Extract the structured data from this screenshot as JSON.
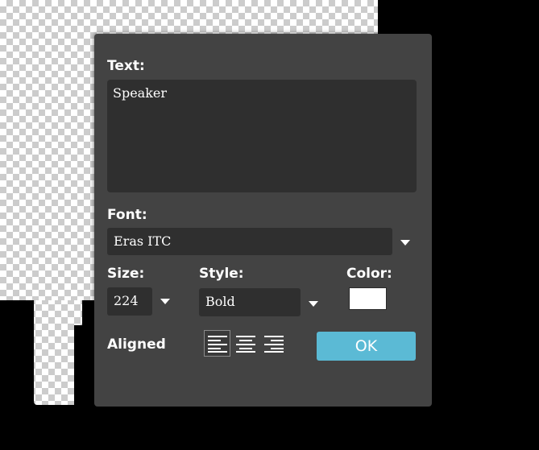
{
  "dialog": {
    "text_label": "Text:",
    "text_value": "Speaker",
    "font_label": "Font:",
    "font_value": "Eras ITC",
    "size_label": "Size:",
    "size_value": "224",
    "style_label": "Style:",
    "style_value": "Bold",
    "color_label": "Color:",
    "color_value": "#ffffff",
    "aligned_label": "Aligned",
    "alignment_options": [
      "align-left-icon",
      "align-center-icon",
      "align-right-icon"
    ],
    "alignment_selected": "align-left-icon",
    "ok_label": "OK"
  },
  "colors": {
    "accent": "#5bbad5",
    "dialog_bg": "#434343",
    "field_bg": "#2f2f2f"
  }
}
